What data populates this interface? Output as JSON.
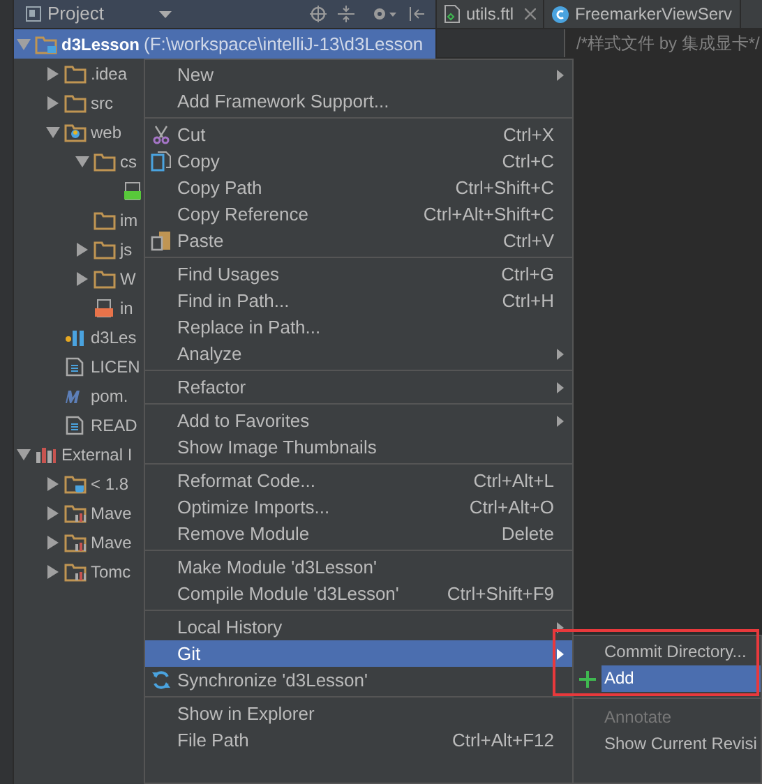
{
  "project_panel": {
    "title": "Project"
  },
  "editor_tabs": [
    {
      "label": "utils.ftl",
      "kind": "ftl",
      "closable": true
    },
    {
      "label": "FreemarkerViewServ",
      "kind": "class",
      "closable": false
    }
  ],
  "editor": {
    "line": "/*样式文件 by 集成显卡*/"
  },
  "tree": [
    {
      "label": "d3Lesson",
      "path": "(F:\\workspace\\intelliJ-13\\d3Lesson",
      "kind": "module",
      "expanded": true,
      "selected": true,
      "children": [
        {
          "label": ".idea",
          "kind": "folder",
          "expanded": false,
          "selected": false
        },
        {
          "label": "src",
          "kind": "folder",
          "expanded": false,
          "selected": false
        },
        {
          "label": "web",
          "kind": "web",
          "expanded": true,
          "selected": false,
          "children": [
            {
              "label": "cs",
              "kind": "folder",
              "expanded": true,
              "selected": false,
              "children": [
                {
                  "kind": "css",
                  "selected": false
                }
              ]
            },
            {
              "label": "im",
              "kind": "folder",
              "selected": false
            },
            {
              "label": "js",
              "kind": "folder",
              "expanded": false,
              "selected": false
            },
            {
              "label": "W",
              "kind": "folder",
              "expanded": false,
              "selected": false
            },
            {
              "label": "in",
              "kind": "jsp",
              "selected": false
            }
          ]
        },
        {
          "label": "d3Les",
          "kind": "iml",
          "selected": false
        },
        {
          "label": "LICEN",
          "kind": "text",
          "selected": false
        },
        {
          "label": "pom.",
          "kind": "maven",
          "selected": false
        },
        {
          "label": "READ",
          "kind": "text",
          "selected": false
        }
      ]
    },
    {
      "label": "External I",
      "kind": "libraries",
      "expanded": true,
      "selected": false,
      "children": [
        {
          "label": "< 1.8",
          "kind": "jdk",
          "expanded": false,
          "selected": false
        },
        {
          "label": "Mave",
          "kind": "library",
          "expanded": false,
          "selected": false
        },
        {
          "label": "Mave",
          "kind": "library",
          "expanded": false,
          "selected": false
        },
        {
          "label": "Tomc",
          "kind": "library",
          "expanded": false,
          "selected": false
        }
      ]
    }
  ],
  "context_menu": [
    [
      {
        "label": "New",
        "submenu": true,
        "selected": false
      },
      {
        "label": "Add Framework Support...",
        "submenu": false,
        "selected": false
      }
    ],
    [
      {
        "label": "Cut",
        "shortcut": "Ctrl+X",
        "submenu": false,
        "selected": false
      },
      {
        "label": "Copy",
        "shortcut": "Ctrl+C",
        "submenu": false,
        "selected": false
      },
      {
        "label": "Copy Path",
        "shortcut": "Ctrl+Shift+C",
        "submenu": false,
        "selected": false
      },
      {
        "label": "Copy Reference",
        "shortcut": "Ctrl+Alt+Shift+C",
        "submenu": false,
        "selected": false
      },
      {
        "label": "Paste",
        "shortcut": "Ctrl+V",
        "submenu": false,
        "selected": false
      }
    ],
    [
      {
        "label": "Find Usages",
        "shortcut": "Ctrl+G",
        "submenu": false,
        "selected": false
      },
      {
        "label": "Find in Path...",
        "shortcut": "Ctrl+H",
        "submenu": false,
        "selected": false
      },
      {
        "label": "Replace in Path...",
        "submenu": false,
        "selected": false
      },
      {
        "label": "Analyze",
        "submenu": true,
        "selected": false
      }
    ],
    [
      {
        "label": "Refactor",
        "submenu": true,
        "selected": false
      }
    ],
    [
      {
        "label": "Add to Favorites",
        "submenu": true,
        "selected": false
      },
      {
        "label": "Show Image Thumbnails",
        "submenu": false,
        "selected": false
      }
    ],
    [
      {
        "label": "Reformat Code...",
        "shortcut": "Ctrl+Alt+L",
        "submenu": false,
        "selected": false
      },
      {
        "label": "Optimize Imports...",
        "shortcut": "Ctrl+Alt+O",
        "submenu": false,
        "selected": false
      },
      {
        "label": "Remove Module",
        "shortcut": "Delete",
        "submenu": false,
        "selected": false
      }
    ],
    [
      {
        "label": "Make Module 'd3Lesson'",
        "submenu": false,
        "selected": false
      },
      {
        "label": "Compile Module 'd3Lesson'",
        "shortcut": "Ctrl+Shift+F9",
        "submenu": false,
        "selected": false
      }
    ],
    [
      {
        "label": "Local History",
        "submenu": true,
        "selected": false
      },
      {
        "label": "Git",
        "submenu": true,
        "selected": true
      },
      {
        "label": "Synchronize 'd3Lesson'",
        "submenu": false,
        "selected": false
      }
    ],
    [
      {
        "label": "Show in Explorer",
        "submenu": false,
        "selected": false
      },
      {
        "label": "File Path",
        "shortcut": "Ctrl+Alt+F12",
        "submenu": false,
        "selected": false
      }
    ]
  ],
  "git_submenu": [
    [
      {
        "label": "Commit Directory...",
        "selected": false
      },
      {
        "label": "Add",
        "selected": true
      }
    ],
    [
      {
        "label": "Annotate",
        "selected": false,
        "disabled": true
      },
      {
        "label": "Show Current Revisi",
        "selected": false,
        "disabled": false
      }
    ]
  ],
  "highlight_box": {
    "shown": true
  }
}
